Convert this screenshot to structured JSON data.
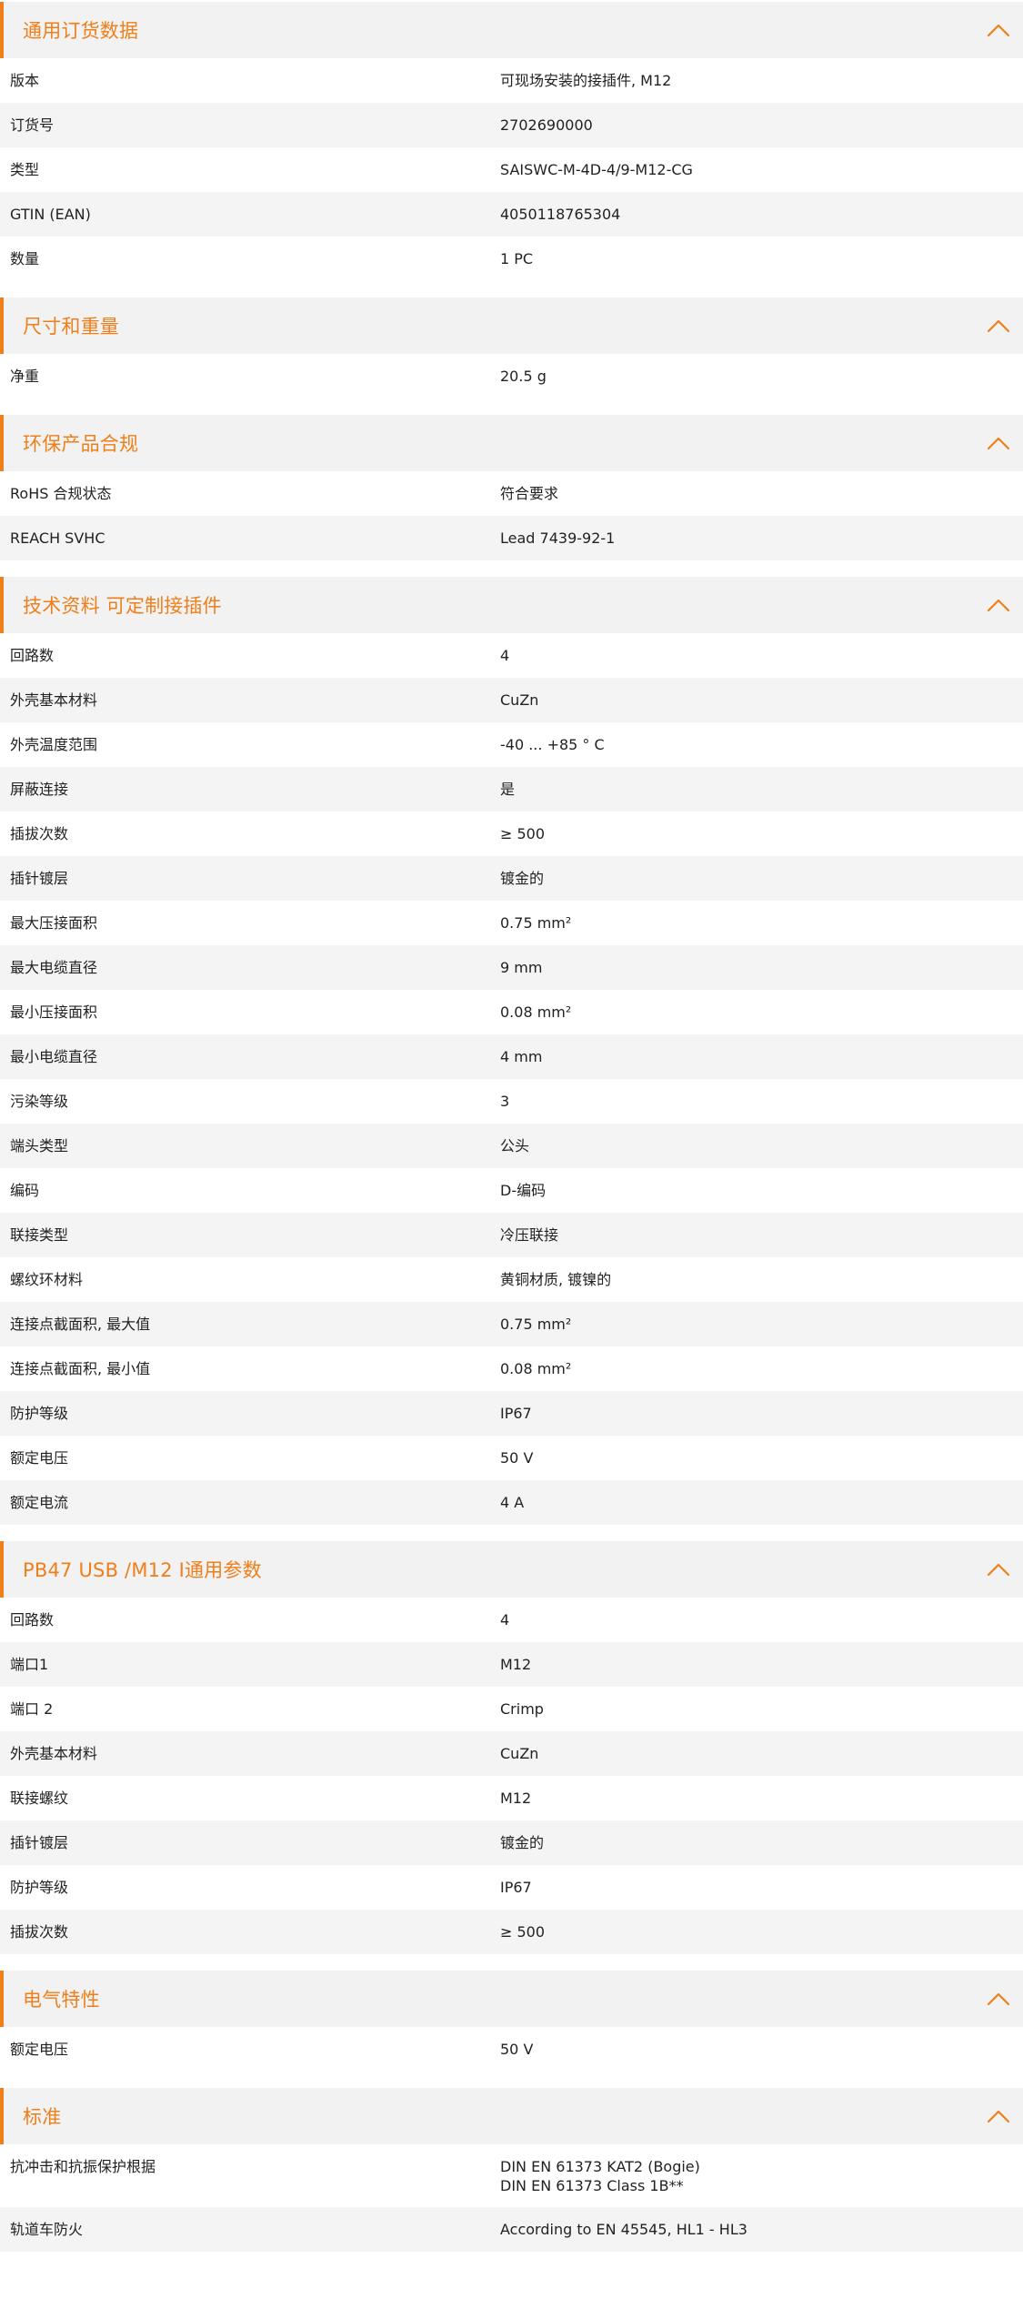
{
  "colors": {
    "accent": "#ee7f1a",
    "header_bg": "#f2f2f2",
    "row_alt_bg": "#f4f4f4"
  },
  "icons": {
    "section_toggle": "chevron-up-icon"
  },
  "sections": [
    {
      "id": "ordering",
      "title": "通用订货数据",
      "rows": [
        {
          "label": "版本",
          "value": [
            "可现场安装的接插件, M12"
          ]
        },
        {
          "label": "订货号",
          "value": [
            "2702690000"
          ]
        },
        {
          "label": "类型",
          "value": [
            "SAISWC-M-4D-4/9-M12-CG"
          ]
        },
        {
          "label": "GTIN (EAN)",
          "value": [
            "4050118765304"
          ]
        },
        {
          "label": "数量",
          "value": [
            "1  PC"
          ]
        }
      ]
    },
    {
      "id": "dimensions",
      "title": "尺寸和重量",
      "rows": [
        {
          "label": "净重",
          "value": [
            "20.5  g"
          ]
        }
      ]
    },
    {
      "id": "compliance",
      "title": "环保产品合规",
      "rows": [
        {
          "label": "RoHS 合规状态",
          "value": [
            "符合要求"
          ]
        },
        {
          "label": "REACH SVHC",
          "value": [
            "Lead 7439-92-1"
          ]
        }
      ]
    },
    {
      "id": "technical",
      "title": "技术资料 可定制接插件",
      "rows": [
        {
          "label": "回路数",
          "value": [
            "4"
          ]
        },
        {
          "label": "外壳基本材料",
          "value": [
            "CuZn"
          ]
        },
        {
          "label": "外壳温度范围",
          "value": [
            "-40 ... +85 ° C"
          ]
        },
        {
          "label": "屏蔽连接",
          "value": [
            "是"
          ]
        },
        {
          "label": "插拔次数",
          "value": [
            "≥ 500"
          ]
        },
        {
          "label": "插针镀层",
          "value": [
            "镀金的"
          ]
        },
        {
          "label": "最大压接面积",
          "value": [
            "0.75  mm²"
          ]
        },
        {
          "label": "最大电缆直径",
          "value": [
            "9  mm"
          ]
        },
        {
          "label": "最小压接面积",
          "value": [
            "0.08  mm²"
          ]
        },
        {
          "label": "最小电缆直径",
          "value": [
            "4  mm"
          ]
        },
        {
          "label": "污染等级",
          "value": [
            "3"
          ]
        },
        {
          "label": "端头类型",
          "value": [
            "公头"
          ]
        },
        {
          "label": "编码",
          "value": [
            "D-编码"
          ]
        },
        {
          "label": "联接类型",
          "value": [
            "冷压联接"
          ]
        },
        {
          "label": "螺纹环材料",
          "value": [
            "黄铜材质, 镀镍的"
          ]
        },
        {
          "label": "连接点截面积, 最大值",
          "value": [
            "0.75  mm²"
          ]
        },
        {
          "label": "连接点截面积, 最小值",
          "value": [
            "0.08  mm²"
          ]
        },
        {
          "label": "防护等级",
          "value": [
            "IP67"
          ]
        },
        {
          "label": "额定电压",
          "value": [
            "50  V"
          ]
        },
        {
          "label": "额定电流",
          "value": [
            "4  A"
          ]
        }
      ]
    },
    {
      "id": "pb47",
      "title": "PB47 USB /M12 I通用参数",
      "rows": [
        {
          "label": "回路数",
          "value": [
            "4"
          ]
        },
        {
          "label": "端口1",
          "value": [
            "M12"
          ]
        },
        {
          "label": "端口 2",
          "value": [
            "Crimp"
          ]
        },
        {
          "label": "外壳基本材料",
          "value": [
            "CuZn"
          ]
        },
        {
          "label": "联接螺纹",
          "value": [
            "M12"
          ]
        },
        {
          "label": "插针镀层",
          "value": [
            "镀金的"
          ]
        },
        {
          "label": "防护等级",
          "value": [
            "IP67"
          ]
        },
        {
          "label": "插拔次数",
          "value": [
            "≥ 500"
          ]
        }
      ]
    },
    {
      "id": "electrical",
      "title": "电气特性",
      "rows": [
        {
          "label": "额定电压",
          "value": [
            "50  V"
          ]
        }
      ]
    },
    {
      "id": "standards",
      "title": "标准",
      "rows": [
        {
          "label": "抗冲击和抗振保护根据",
          "value": [
            "DIN EN 61373 KAT2 (Bogie)",
            "DIN EN 61373 Class 1B**"
          ]
        },
        {
          "label": "轨道车防火",
          "value": [
            "According to EN 45545, HL1 - HL3"
          ]
        }
      ]
    }
  ]
}
